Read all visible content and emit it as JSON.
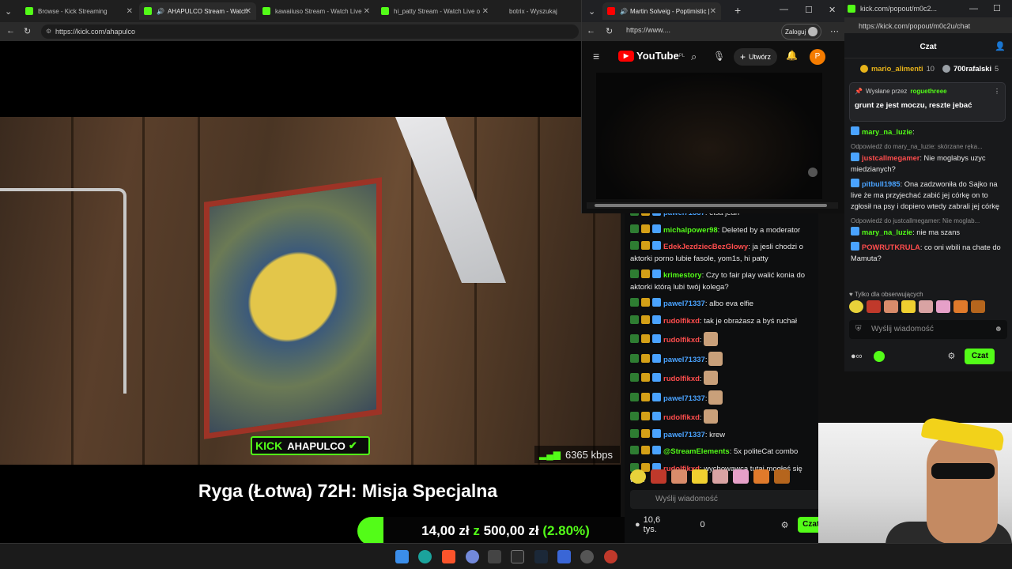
{
  "main_browser": {
    "tabs": [
      {
        "title": "Browse - Kick Streaming",
        "active": false
      },
      {
        "title": "AHAPULCO Stream - Watch",
        "active": true
      },
      {
        "title": "kawaiiuso Stream - Watch Live",
        "active": false
      },
      {
        "title": "hi_patty Stream - Watch Live o",
        "active": false
      },
      {
        "title": "botrix - Wyszukaj",
        "active": false
      }
    ],
    "url": "https://kick.com/ahapulco"
  },
  "stream": {
    "channel_logo": "KICK",
    "channel_name": "AHAPULCO",
    "bitrate": "6365 kbps",
    "title": "Ryga (Łotwa) 72H: Misja Specjalna",
    "goal_current": "14,00 zł",
    "goal_sep": "z",
    "goal_target": "500,00 zł",
    "goal_percent": "(2.80%)",
    "goal_fraction": 0.028
  },
  "kick_chat": {
    "messages": [
      {
        "user": "pawel71337",
        "text": ": elsa jean",
        "color": "#4aa3ff"
      },
      {
        "user": "michalpower98",
        "text": ": Deleted by a moderator",
        "color": "#53fc18"
      },
      {
        "user": "EdekJezdziecBezGlowy",
        "text": ": ja jesli chodzi o aktorki porno lubie fasole, yom1s, hi patty",
        "color": "#ff4d4d"
      },
      {
        "user": "krimestory",
        "text": ": Czy to fair play walić konia do aktorki którą lubi twój kolega?",
        "color": "#53fc18"
      },
      {
        "user": "pawel71337",
        "text": ": albo eva elfie",
        "color": "#4aa3ff"
      },
      {
        "user": "rudolfikxd",
        "text": ": tak je obrażasz a byś ruchał",
        "color": "#ff4d4d"
      },
      {
        "user": "rudolfikxd",
        "text": ":",
        "color": "#ff4d4d",
        "emote": true
      },
      {
        "user": "pawel71337",
        "text": ":",
        "color": "#4aa3ff",
        "emote": true
      },
      {
        "user": "rudolfikxd",
        "text": ":",
        "color": "#ff4d4d",
        "emote": true
      },
      {
        "user": "pawel71337",
        "text": ":",
        "color": "#4aa3ff",
        "emote": true
      },
      {
        "user": "rudolfikxd",
        "text": ":",
        "color": "#ff4d4d",
        "emote": true
      },
      {
        "user": "pawel71337",
        "text": ": krew",
        "color": "#4aa3ff"
      },
      {
        "user": "@StreamElements",
        "text": ": 5x politeCat combo",
        "color": "#53fc18"
      },
      {
        "user": "rudolfikxd",
        "text": ": wychowawca tutaj mogłeś się wysr",
        "color": "#ff4d4d"
      }
    ],
    "input_placeholder": "Wyślij wiadomość",
    "viewers": "10,6 tys.",
    "count": "0",
    "send_label": "Czat"
  },
  "youtube_window": {
    "tab_title": "Martin Solveig - Poptimistic |",
    "url": "https://www....",
    "login_label": "Zaloguj",
    "logo_text": "YouTube",
    "logo_region": "PL",
    "create_label": "Utwórz",
    "avatar_letter": "P"
  },
  "popout_chat": {
    "url_short": "kick.com/popout/m0c2...",
    "url": "https://kick.com/popout/m0c2u/chat",
    "header": "Czat",
    "top_gifters": [
      {
        "user": "mario_alimenti",
        "count": "10"
      },
      {
        "user": "700rafalski",
        "count": "5"
      }
    ],
    "pinned_by_prefix": "Wysłane przez",
    "pinned_by_user": "roguethreee",
    "pinned_text": "grunt ze jest moczu, reszte jebać",
    "messages": [
      {
        "reply": "",
        "user": "mary_na_luzie",
        "text": ":",
        "color": "#53fc18"
      },
      {
        "reply": "Odpowiedź do mary_na_luzie: skórzane ręka...",
        "user": "justcallmegamer",
        "text": ": Nie moglabys uzyc miedzianych?",
        "color": "#ff4d4d"
      },
      {
        "reply": "",
        "user": "pitbull1985",
        "text": ": Ona zadzwoniła do Sajko na live że ma przyjechać zabić jej córkę on to zgłosił na psy i dopiero wtedy zabrali jej córkę",
        "color": "#4aa3ff"
      },
      {
        "reply": "Odpowiedź do justcallmegamer: Nie moglab...",
        "user": "mary_na_luzie",
        "text": ": nie ma szans",
        "color": "#53fc18"
      },
      {
        "reply": "",
        "user": "POWRUTKRULA",
        "text": ": co oni wbili na chate do Mamuta?",
        "color": "#ff4d4d"
      }
    ],
    "followers_only": "Tylko dla obserwujących",
    "input_placeholder": "Wyślij wiadomość",
    "send_label": "Czat"
  },
  "colors": {
    "kick_green": "#53fc18",
    "youtube_red": "#ff0000",
    "chat_bg": "#0d0e0f"
  }
}
